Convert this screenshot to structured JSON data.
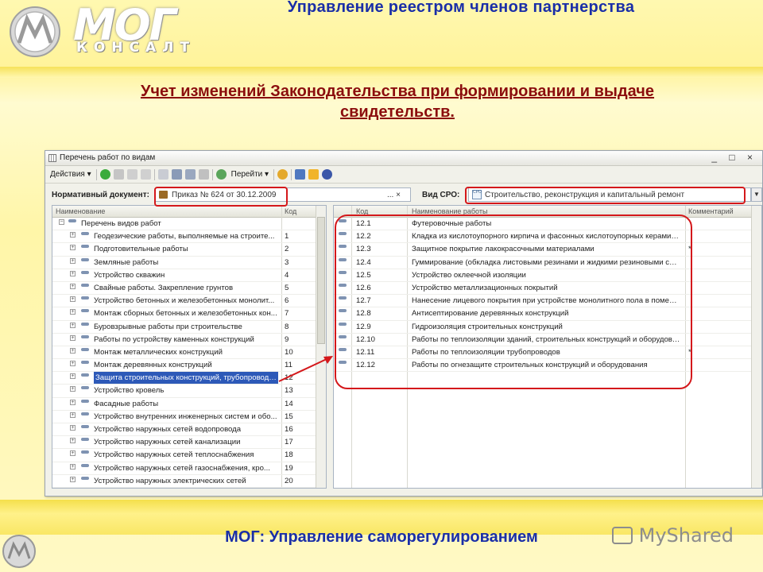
{
  "brand": {
    "logo_text": "МОГ",
    "logo_sub": "КОНСАЛТ"
  },
  "header": {
    "title": "Управление реестром членов партнерства"
  },
  "subtitle": {
    "line1": "Учет изменений Законодательства при формировании  и выдаче",
    "line2": "свидетельств."
  },
  "window": {
    "title": "Перечень работ по видам",
    "controls": "_ □ ×",
    "toolbar": {
      "actions_label": "Действия ▾",
      "goto_label": "Перейти ▾"
    },
    "normative_label": "Нормативный документ:",
    "normative_value": "Приказ № 624 от 30.12.2009",
    "normative_btns": "... ×",
    "sro_label": "Вид СРО:",
    "sro_value": "Строительство, реконструкция и капитальный ремонт",
    "sro_icon_text": "СРО",
    "left_grid": {
      "headers": [
        "Наименование",
        "Код"
      ],
      "root": "Перечень видов работ",
      "rows": [
        {
          "name": "Геодезические работы, выполняемые на строите...",
          "code": "1"
        },
        {
          "name": "Подготовительные работы",
          "code": "2"
        },
        {
          "name": "Земляные работы",
          "code": "3"
        },
        {
          "name": "Устройство скважин",
          "code": "4"
        },
        {
          "name": "Свайные работы. Закрепление грунтов",
          "code": "5"
        },
        {
          "name": "Устройство бетонных и железобетонных монолит...",
          "code": "6"
        },
        {
          "name": "Монтаж сборных бетонных и железобетонных кон...",
          "code": "7"
        },
        {
          "name": "Буровзрывные работы при строительстве",
          "code": "8"
        },
        {
          "name": "Работы по устройству каменных конструкций",
          "code": "9"
        },
        {
          "name": "Монтаж металлических конструкций",
          "code": "10"
        },
        {
          "name": "Монтаж деревянных конструкций",
          "code": "11"
        },
        {
          "name": "Защита строительных конструкций, трубопроводо...",
          "code": "12"
        },
        {
          "name": "Устройство кровель",
          "code": "13"
        },
        {
          "name": "Фасадные работы",
          "code": "14"
        },
        {
          "name": "Устройство внутренних инженерных систем и обо...",
          "code": "15"
        },
        {
          "name": "Устройство наружных сетей водопровода",
          "code": "16"
        },
        {
          "name": "Устройство наружных сетей канализации",
          "code": "17"
        },
        {
          "name": "Устройство наружных сетей теплоснабжения",
          "code": "18"
        },
        {
          "name": "Устройство наружных сетей газоснабжения, кро...",
          "code": "19"
        },
        {
          "name": "Устройство наружных электрических сетей",
          "code": "20"
        }
      ]
    },
    "right_grid": {
      "headers": [
        "Код",
        "Наименование работы",
        "Комментарий"
      ],
      "rows": [
        {
          "code": "12.1",
          "name": "Футеровочные работы",
          "comment": ""
        },
        {
          "code": "12.2",
          "name": "Кладка из кислотоупорного кирпича и фасонных кислотоупорных керамиче...",
          "comment": ""
        },
        {
          "code": "12.3",
          "name": "Защитное покрытие лакокрасочными материалами",
          "comment": "*"
        },
        {
          "code": "12.4",
          "name": "Гуммирование (обкладка листовыми резинами и жидкими резиновыми сме...",
          "comment": ""
        },
        {
          "code": "12.5",
          "name": "Устройство оклеечной изоляции",
          "comment": ""
        },
        {
          "code": "12.6",
          "name": "Устройство металлизационных покрытий",
          "comment": ""
        },
        {
          "code": "12.7",
          "name": "Нанесение лицевого покрытия при устройстве монолитного пола в помеще...",
          "comment": ""
        },
        {
          "code": "12.8",
          "name": "Антисептирование деревянных конструкций",
          "comment": ""
        },
        {
          "code": "12.9",
          "name": "Гидроизоляция строительных конструкций",
          "comment": ""
        },
        {
          "code": "12.10",
          "name": "Работы по теплоизоляции зданий, строительных конструкций и оборудования",
          "comment": ""
        },
        {
          "code": "12.11",
          "name": "Работы по теплоизоляции трубопроводов",
          "comment": "*"
        },
        {
          "code": "12.12",
          "name": "Работы по огнезащите строительных конструкций и оборудования",
          "comment": ""
        }
      ]
    }
  },
  "footer": {
    "title": "МОГ: Управление саморегулированием",
    "watermark": "MyShared"
  },
  "colors": {
    "accent_blue": "#1a2ea8",
    "subtitle_red": "#8b0d0d",
    "highlight_red": "#d4181b"
  }
}
